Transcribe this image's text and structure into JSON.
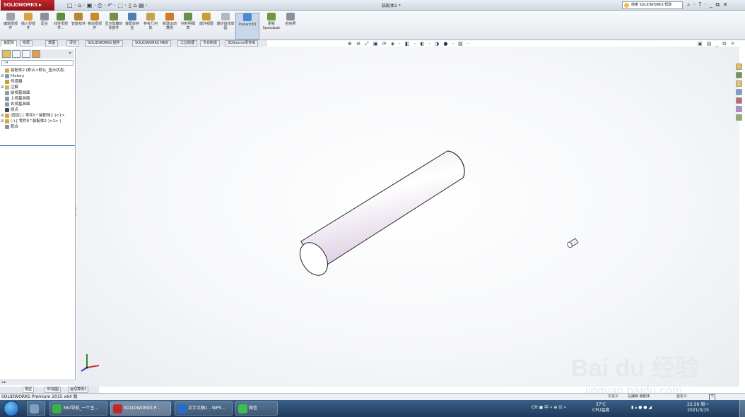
{
  "app": {
    "brand": "SOLIDWORKS",
    "window_title": "装配体2 *",
    "quick_access": "□ · ⌂ · ▣ · ⎙ · ↶ · ⬚ · ▯ ⌂ ▤ ·",
    "help_search": "搜索 SOLIDWORKS 帮助",
    "title_right": "⌕ · ? · _ ⧉ ✕"
  },
  "ribbon": {
    "buttons": [
      {
        "label": "编辑零部件",
        "icon": "edit-component-icon",
        "color": "#9aa3ad"
      },
      {
        "label": "插入零部件",
        "icon": "insert-component-icon",
        "color": "#d9a23a"
      },
      {
        "label": "配合",
        "icon": "mate-icon",
        "color": "#8a8f99"
      },
      {
        "label": "线性零部件...",
        "icon": "linear-pattern-icon",
        "color": "#5d8f3c"
      },
      {
        "label": "智能扣件",
        "icon": "smart-fastener-icon",
        "color": "#b8862f"
      },
      {
        "label": "移动零部件",
        "icon": "move-component-icon",
        "color": "#c98a2a"
      },
      {
        "label": "显示隐藏的零部件",
        "icon": "show-hidden-icon",
        "color": "#7a8d4a"
      },
      {
        "label": "装配体特征",
        "icon": "assembly-feature-icon",
        "color": "#4f7fb0"
      },
      {
        "label": "参考几何体",
        "icon": "reference-geometry-icon",
        "color": "#c4a34a"
      },
      {
        "label": "新建运动算例",
        "icon": "motion-study-icon",
        "color": "#d07a2a"
      },
      {
        "label": "材料明细表",
        "icon": "bom-icon",
        "color": "#6a8f4a"
      },
      {
        "label": "爆炸视图",
        "icon": "explode-icon",
        "color": "#c9a030"
      },
      {
        "label": "爆炸直线草图",
        "icon": "explode-line-icon",
        "color": "#b0b8c2"
      },
      {
        "label": "Instant3D",
        "icon": "instant3d-icon",
        "color": "#4a8ad0"
      },
      {
        "label": "更新Speedpak",
        "icon": "speedpak-icon",
        "color": "#6a9a3a"
      },
      {
        "label": "拍快照",
        "icon": "snapshot-icon",
        "color": "#8a90a0"
      }
    ]
  },
  "tabs": [
    "装配体",
    "布局",
    "草图",
    "评估",
    "SOLIDWORKS 插件",
    "SOLIDWORKS MBD",
    "工业助理",
    "今日制造",
    "3DSource零件库"
  ],
  "view_toolbar": "⊕ ⊖ ⤢ ▣ ⟳ ◈ · ◧ · ◐ · ◑ ● · ▤ ·",
  "window_controls": "▣ ▤ _ ⧉ ✕",
  "feature_tree": {
    "collapse_label": "»",
    "filter": "▽▾",
    "nodes": [
      {
        "label": "装配体2  (默认<默认_显示状态-",
        "icon": "assembly-icon",
        "color": "#d9a23a",
        "expand": ""
      },
      {
        "label": "History",
        "icon": "history-icon",
        "color": "#7a9ac0",
        "expand": "⊞"
      },
      {
        "label": "传感器",
        "icon": "sensor-icon",
        "color": "#c9a030",
        "expand": ""
      },
      {
        "label": "注解",
        "icon": "annotation-icon",
        "color": "#d0b050",
        "expand": "⊞"
      },
      {
        "label": "前视基准面",
        "icon": "plane-icon",
        "color": "#8a9ab0",
        "expand": ""
      },
      {
        "label": "上视基准面",
        "icon": "plane-icon",
        "color": "#8a9ab0",
        "expand": ""
      },
      {
        "label": "右视基准面",
        "icon": "plane-icon",
        "color": "#8a9ab0",
        "expand": ""
      },
      {
        "label": "原点",
        "icon": "origin-icon",
        "color": "#445",
        "expand": ""
      },
      {
        "label": "(固定) [ 零件5^装配体2 ]<1>",
        "icon": "part-icon",
        "color": "#d9a23a",
        "expand": "⊞"
      },
      {
        "label": "(-) [ 零件6^装配体2 ]<1> (",
        "icon": "part-icon",
        "color": "#d9a23a",
        "expand": "⊞"
      },
      {
        "label": "配合",
        "icon": "mates-folder-icon",
        "color": "#8a8f99",
        "expand": ""
      }
    ]
  },
  "bottom_tabs": [
    "模型",
    "3D视图",
    "运动算例1"
  ],
  "h_scroll": "◂        ▸",
  "status": {
    "product": "SOLIDWORKS Premium 2015 x64 版",
    "right_items": [
      "欠定义",
      "在编辑 装配体",
      "自定义 ·"
    ],
    "help": "?"
  },
  "watermark": {
    "line1": "Bai du 经验",
    "line2": "jingyan.baidu.com"
  },
  "taskbar": {
    "items": [
      {
        "label": "",
        "icon": "explorer-icon",
        "color": "#7aa0c8"
      },
      {
        "label": "360导航_一个主...",
        "icon": "browser-icon",
        "color": "#3ab04a"
      },
      {
        "label": "SOLIDWORKS P...",
        "icon": "solidworks-icon",
        "color": "#c1272d"
      },
      {
        "label": "文字文稿1 - WPS...",
        "icon": "wps-icon",
        "color": "#2a6ac8"
      },
      {
        "label": "微信",
        "icon": "wechat-icon",
        "color": "#3ac04a"
      }
    ],
    "tray_icons": "CH ▣ 中 ⸰ ⊕ ☑ ⸰",
    "temp": "37℃",
    "cpu": "CPU温度",
    "tray2": "▮ ▴ ● ● ◢",
    "time": "22:26 周一",
    "date": "2021/3/15"
  }
}
